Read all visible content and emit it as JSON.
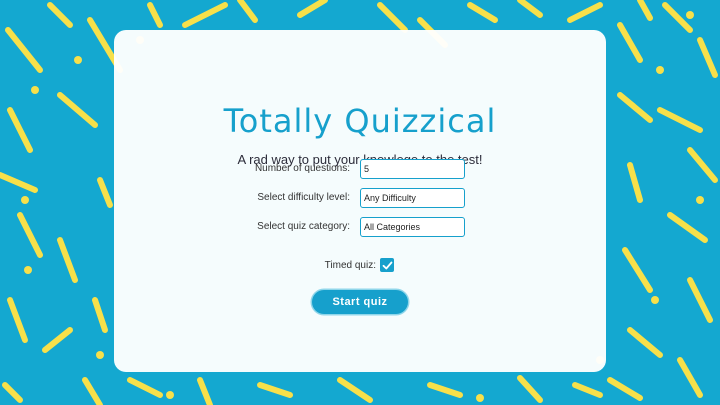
{
  "app": {
    "title": "Totally Quizzical",
    "subtitle": "A rad way to put your knowlege to the test!"
  },
  "form": {
    "questions": {
      "label": "Number of questions:",
      "value": "5"
    },
    "difficulty": {
      "label": "Select difficulty level:",
      "value": "Any Difficulty"
    },
    "category": {
      "label": "Select quiz category:",
      "value": "All Categories"
    },
    "timed": {
      "label": "Timed quiz:",
      "checked": true,
      "icon": "checkmark-icon"
    },
    "start_label": "Start quiz"
  },
  "colors": {
    "background": "#14a8d0",
    "accent": "#16a0cc",
    "pattern": "#f7e04a",
    "card": "#ffffff"
  }
}
